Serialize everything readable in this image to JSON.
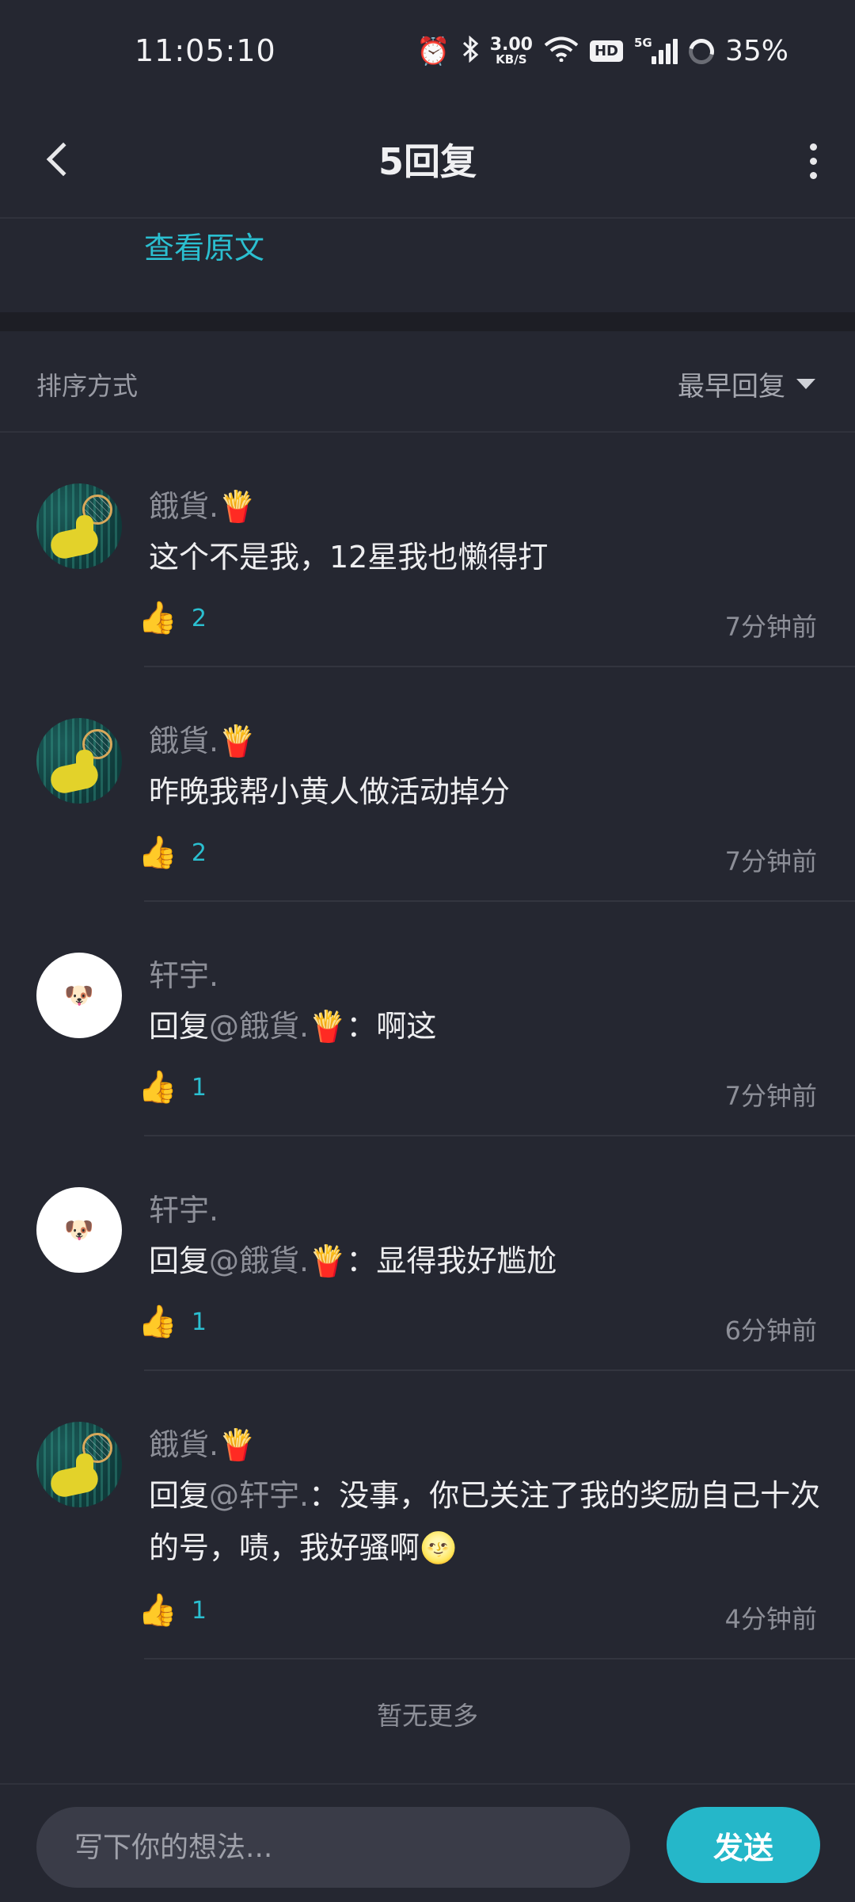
{
  "status_bar": {
    "time": "11:05:10",
    "net_speed_value": "3.00",
    "net_speed_unit": "KB/S",
    "hd": "HD",
    "network": "5G",
    "battery": "35%"
  },
  "header": {
    "title": "5回复"
  },
  "view_original": "查看原文",
  "sort": {
    "label": "排序方式",
    "value": "最早回复"
  },
  "comments": [
    {
      "username": "餓貨.🍟",
      "text": "这个不是我，12星我也懒得打",
      "likes": "2",
      "time": "7分钟前"
    },
    {
      "username": "餓貨.🍟",
      "text": "昨晚我帮小黄人做活动掉分",
      "likes": "2",
      "time": "7分钟前"
    },
    {
      "username": "轩宇.",
      "reply_prefix": "回复",
      "mention": "@餓貨.🍟",
      "text": "：啊这",
      "likes": "1",
      "time": "7分钟前"
    },
    {
      "username": "轩宇.",
      "reply_prefix": "回复",
      "mention": "@餓貨.🍟",
      "text": "：显得我好尴尬",
      "likes": "1",
      "time": "6分钟前"
    },
    {
      "username": "餓貨.🍟",
      "reply_prefix": "回复",
      "mention": "@轩宇.",
      "text": "：没事，你已关注了我的奖励自己十次的号，啧，我好骚啊🌝",
      "likes": "1",
      "time": "4分钟前"
    }
  ],
  "no_more": "暂无更多",
  "input": {
    "placeholder": "写下你的想法...",
    "send_label": "发送"
  },
  "colors": {
    "background": "#252731",
    "accent": "#25b7c9",
    "muted_text": "#8d8f98"
  }
}
